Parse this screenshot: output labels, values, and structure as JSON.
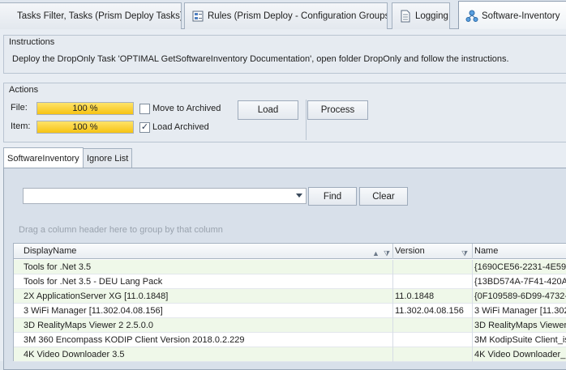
{
  "tabs": [
    {
      "label": "Tasks Filter, Tasks (Prism Deploy Tasks)",
      "icon": "tasks-icon"
    },
    {
      "label": "Rules (Prism Deploy - Configuration Groups)",
      "icon": "rules-icon"
    },
    {
      "label": "Logging",
      "icon": "document-icon"
    },
    {
      "label": "Software-Inventory",
      "icon": "network-icon",
      "active": true
    }
  ],
  "instructions": {
    "title": "Instructions",
    "text": "Deploy the DropOnly Task 'OPTIMAL GetSoftwareInventory Documentation', open folder DropOnly and follow the instructions."
  },
  "actions": {
    "title": "Actions",
    "file_label": "File:",
    "file_progress_text": "100 %",
    "file_progress": 1.0,
    "item_label": "Item:",
    "item_progress_text": "100 %",
    "item_progress": 1.0,
    "move_to_archived_label": "Move to Archived",
    "move_to_archived_checked": false,
    "load_archived_label": "Load Archived",
    "load_archived_checked": true,
    "load_button": "Load",
    "process_button": "Process"
  },
  "inner_tabs": [
    {
      "label": "SoftwareInventory",
      "active": true
    },
    {
      "label": "Ignore List"
    }
  ],
  "filter": {
    "value": "",
    "find_button": "Find",
    "clear_button": "Clear"
  },
  "group_hint": "Drag a column header here to group by that column",
  "grid": {
    "columns": [
      "DisplayName",
      "Version",
      "Name"
    ],
    "rows": [
      {
        "display_name": "Tools for .Net 3.5",
        "version": "",
        "name": "{1690CE56-2231-4E59-"
      },
      {
        "display_name": "Tools for .Net 3.5 - DEU Lang Pack",
        "version": "",
        "name": "{13BD574A-7F41-420A-"
      },
      {
        "display_name": "2X ApplicationServer XG [11.0.1848]",
        "version": "11.0.1848",
        "name": "{0F109589-6D99-4732-"
      },
      {
        "display_name": "3 WiFi Manager [11.302.04.08.156]",
        "version": "11.302.04.08.156",
        "name": "3 WiFi Manager [11.302"
      },
      {
        "display_name": "3D RealityMaps Viewer 2 2.5.0.0",
        "version": "",
        "name": "3D RealityMaps Viewer2"
      },
      {
        "display_name": "3M 360 Encompass KODIP Client Version 2018.0.2.229",
        "version": "",
        "name": "3M KodipSuite Client_is"
      },
      {
        "display_name": "4K Video Downloader 3.5",
        "version": "",
        "name": "4K Video Downloader_is"
      }
    ]
  }
}
